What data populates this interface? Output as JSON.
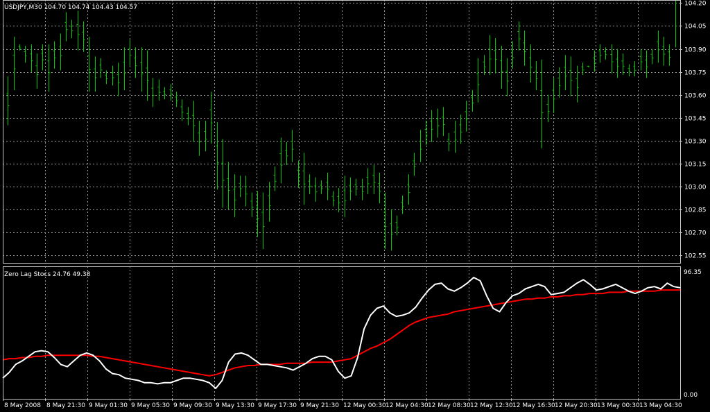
{
  "colors": {
    "background": "#000000",
    "grid": "#9a9a9a",
    "frame": "#c8c8c8",
    "candles": "#00cc00",
    "stoch_main": "#ffffff",
    "stoch_signal": "#ff0000"
  },
  "price_panel": {
    "title": "USDJPY,M30  104.70 104.74 104.43 104.57",
    "y_ticks": [
      "104.20",
      "104.05",
      "103.90",
      "103.75",
      "103.60",
      "103.45",
      "103.30",
      "103.15",
      "103.00",
      "102.85",
      "102.70",
      "102.55"
    ]
  },
  "indicator_panel": {
    "title": "Zero Lag Stocs 24.76 49.38",
    "y_top_label": "96.35",
    "y_bottom_label": "0.00"
  },
  "x_ticks": [
    "8 May 2008",
    "8 May 21:30",
    "9 May 01:30",
    "9 May 05:30",
    "9 May 09:30",
    "9 May 13:30",
    "9 May 17:30",
    "9 May 21:30",
    "12 May 00:30",
    "12 May 04:30",
    "12 May 08:30",
    "12 May 12:30",
    "12 May 16:30",
    "12 May 20:30",
    "13 May 00:30",
    "13 May 04:30"
  ],
  "chart_data": [
    {
      "type": "bar",
      "title": "USDJPY,M30  104.70 104.74 104.43 104.57",
      "ylim": [
        102.5,
        104.22
      ],
      "y_ticks": [
        104.2,
        104.05,
        103.9,
        103.75,
        103.6,
        103.45,
        103.3,
        103.15,
        103.0,
        102.85,
        102.7,
        102.55
      ],
      "series": [
        {
          "high": [
            103.72,
            103.98,
            103.93,
            103.92,
            103.93,
            103.87,
            103.93,
            103.93,
            103.95,
            104.0,
            104.14,
            104.09,
            104.15,
            104.08,
            103.98,
            103.85,
            103.84,
            103.76,
            103.79,
            103.81,
            103.91,
            103.96,
            103.91,
            103.91,
            103.89,
            103.71,
            103.7,
            103.65,
            103.67,
            103.62,
            103.57,
            103.52,
            103.56,
            103.43,
            103.43,
            103.62,
            103.42,
            103.31,
            103.16,
            103.08,
            103.07,
            103.07,
            102.96,
            102.97,
            102.96,
            103.03,
            103.13,
            103.32,
            103.29,
            103.37,
            103.17,
            103.22,
            103.08,
            103.06,
            103.04,
            103.09,
            102.97,
            102.99,
            103.07,
            103.06,
            103.05,
            103.05,
            103.12,
            103.14,
            103.09,
            102.96,
            102.85,
            102.81,
            102.94,
            103.08,
            103.22,
            103.37,
            103.43,
            103.5,
            103.51,
            103.52,
            103.35,
            103.43,
            103.47,
            103.56,
            103.63,
            103.84,
            103.86,
            103.99,
            103.97,
            103.92,
            103.84,
            103.95,
            104.08,
            104.02,
            103.93,
            103.82,
            103.83,
            103.6,
            103.71,
            103.78,
            103.86,
            103.85,
            103.79,
            103.81,
            103.79,
            103.89,
            103.93,
            103.91,
            103.93,
            103.9,
            103.87,
            103.8,
            103.82,
            103.9,
            103.89,
            103.9,
            104.02,
            103.98,
            103.93,
            103.91
          ]
        },
        {
          "low": [
            103.4,
            103.63,
            103.89,
            103.81,
            103.75,
            103.64,
            103.76,
            103.62,
            103.77,
            103.76,
            103.95,
            103.97,
            103.89,
            103.88,
            103.62,
            103.62,
            103.71,
            103.67,
            103.66,
            103.59,
            103.63,
            103.79,
            103.71,
            103.62,
            103.56,
            103.52,
            103.56,
            103.57,
            103.56,
            103.52,
            103.43,
            103.4,
            103.29,
            103.2,
            103.23,
            103.28,
            102.98,
            102.86,
            102.85,
            102.8,
            102.93,
            102.87,
            102.8,
            102.67,
            102.59,
            102.77,
            102.97,
            103.02,
            103.14,
            103.16,
            102.99,
            102.88,
            102.95,
            102.9,
            102.95,
            102.91,
            102.87,
            102.83,
            102.8,
            102.91,
            102.94,
            102.91,
            102.95,
            102.95,
            102.89,
            102.59,
            102.58,
            102.68,
            102.82,
            102.88,
            103.07,
            103.16,
            103.27,
            103.29,
            103.32,
            103.33,
            103.23,
            103.22,
            103.28,
            103.36,
            103.49,
            103.55,
            103.73,
            103.73,
            103.74,
            103.64,
            103.59,
            103.77,
            103.89,
            103.79,
            103.68,
            103.63,
            103.25,
            103.42,
            103.48,
            103.58,
            103.63,
            103.59,
            103.55,
            103.73,
            103.78,
            103.75,
            103.81,
            103.83,
            103.74,
            103.71,
            103.73,
            103.72,
            103.72,
            103.76,
            103.71,
            103.8,
            103.81,
            103.79,
            103.79
          ]
        }
      ]
    },
    {
      "type": "line",
      "title": "Zero Lag Stocs 24.76 49.38",
      "ylim": [
        0,
        96.35
      ],
      "series": [
        {
          "values": [
            12,
            17,
            24,
            27,
            31,
            35,
            36,
            35,
            30,
            24,
            22,
            27,
            32,
            34,
            32,
            27,
            20,
            16,
            15,
            12,
            11,
            10,
            8,
            8,
            7,
            8,
            8,
            10,
            12,
            12,
            11,
            10,
            8,
            3,
            10,
            26,
            33,
            34,
            32,
            28,
            24,
            24,
            23,
            22,
            21,
            19,
            22,
            25,
            29,
            31,
            31,
            28,
            18,
            12,
            14,
            30,
            55,
            67,
            73,
            75,
            69,
            66,
            67,
            69,
            74,
            82,
            89,
            94,
            95,
            90,
            88,
            91,
            95,
            100,
            97,
            84,
            73,
            70,
            78,
            84,
            86,
            90,
            92,
            94,
            92,
            85,
            86,
            87,
            91,
            95,
            98,
            94,
            89,
            90,
            92,
            94,
            91,
            88,
            86,
            88,
            91,
            92,
            90,
            95,
            92,
            91
          ]
        },
        {
          "values": [
            28,
            29,
            29,
            30,
            30,
            31,
            31,
            32,
            32,
            32,
            32,
            32,
            32,
            32,
            31,
            31,
            30,
            29,
            28,
            27,
            26,
            25,
            24,
            23,
            22,
            21,
            20,
            19,
            18,
            17,
            16,
            15,
            14,
            15,
            17,
            19,
            21,
            22,
            23,
            23,
            24,
            24,
            24,
            24,
            25,
            25,
            25,
            25,
            26,
            26,
            26,
            26,
            27,
            28,
            29,
            32,
            35,
            38,
            40,
            43,
            46,
            50,
            54,
            58,
            61,
            63,
            65,
            66,
            67,
            68,
            70,
            71,
            72,
            73,
            74,
            75,
            76,
            77,
            78,
            79,
            80,
            81,
            81,
            82,
            82,
            83,
            83,
            84,
            84,
            85,
            85,
            86,
            86,
            86,
            87,
            87,
            87,
            88,
            88,
            88,
            88,
            88,
            89,
            89,
            89,
            89
          ]
        }
      ]
    }
  ]
}
